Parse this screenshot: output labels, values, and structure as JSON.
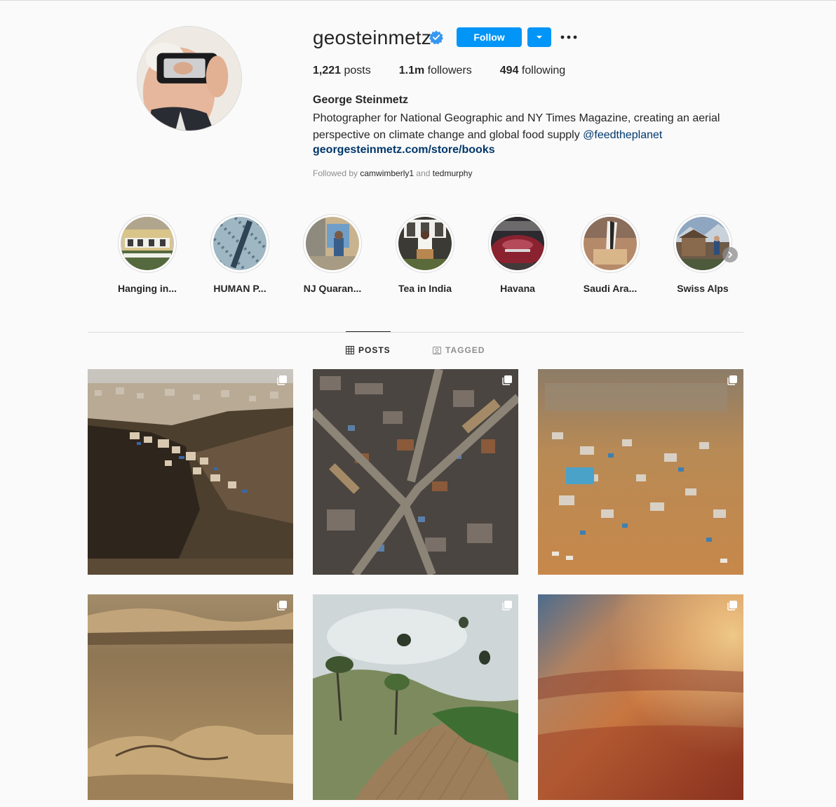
{
  "profile": {
    "username": "geosteinmetz",
    "verified": true,
    "follow_label": "Follow",
    "posts_count": "1,221",
    "posts_label": " posts",
    "followers_count": "1.1m",
    "followers_label": " followers",
    "following_count": "494",
    "following_label": " following",
    "full_name": "George Steinmetz",
    "bio_text": "Photographer for National Geographic and NY Times Magazine, creating an aerial perspective on climate change and global food supply ",
    "bio_mention": "@feedtheplanet",
    "website": "georgesteinmetz.com/store/books",
    "followed_by_prefix": "Followed by ",
    "followed_by_user1": "camwimberly1",
    "followed_by_and": " and ",
    "followed_by_user2": "tedmurphy"
  },
  "highlights": [
    {
      "label": "Hanging in..."
    },
    {
      "label": "HUMAN P..."
    },
    {
      "label": "NJ Quaran..."
    },
    {
      "label": "Tea in India"
    },
    {
      "label": "Havana"
    },
    {
      "label": "Saudi Ara..."
    },
    {
      "label": "Swiss Alps"
    }
  ],
  "tabs": {
    "posts": "POSTS",
    "tagged": "TAGGED"
  },
  "colors": {
    "accent": "#0095f6",
    "link": "#00376b",
    "muted": "#8e8e8e",
    "text": "#262626",
    "background": "#fafafa"
  },
  "icons": [
    "verified-badge-icon",
    "chevron-down-icon",
    "more-options-icon",
    "chevron-right-icon",
    "grid-icon",
    "tagged-icon",
    "multiple-images-icon"
  ]
}
